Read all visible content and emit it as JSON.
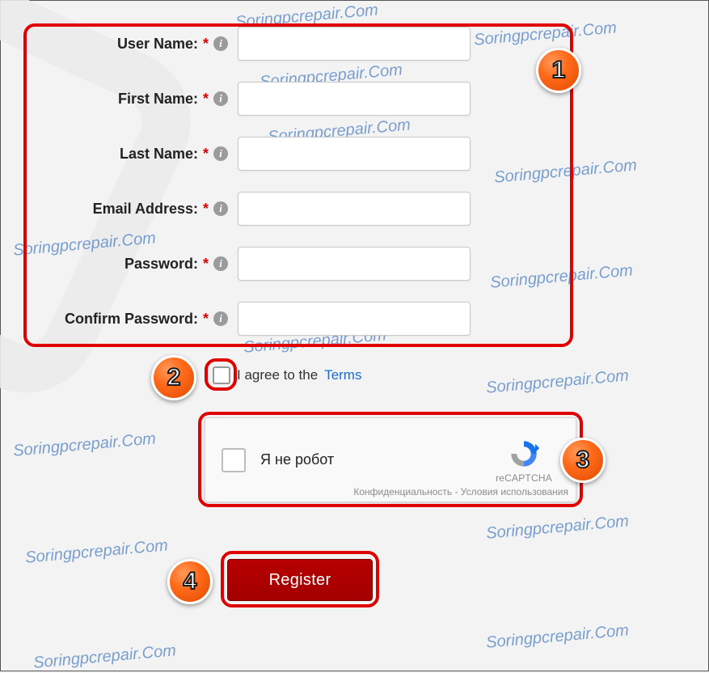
{
  "watermark_text": "Soringpcrepair.Com",
  "form": {
    "fields": [
      {
        "label": "User Name:"
      },
      {
        "label": "First Name:"
      },
      {
        "label": "Last Name:"
      },
      {
        "label": "Email Address:"
      },
      {
        "label": "Password:"
      },
      {
        "label": "Confirm Password:"
      }
    ]
  },
  "terms": {
    "prefix": "I agree to the ",
    "link": "Terms"
  },
  "captcha": {
    "label": "Я не робот",
    "brand": "reCAPTCHA",
    "privacy": "Конфиденциальность",
    "sep": " - ",
    "usage": "Условия использования"
  },
  "register_label": "Register",
  "annotations": {
    "b1": "1",
    "b2": "2",
    "b3": "3",
    "b4": "4"
  },
  "required_marker": "*",
  "info_glyph": "i"
}
